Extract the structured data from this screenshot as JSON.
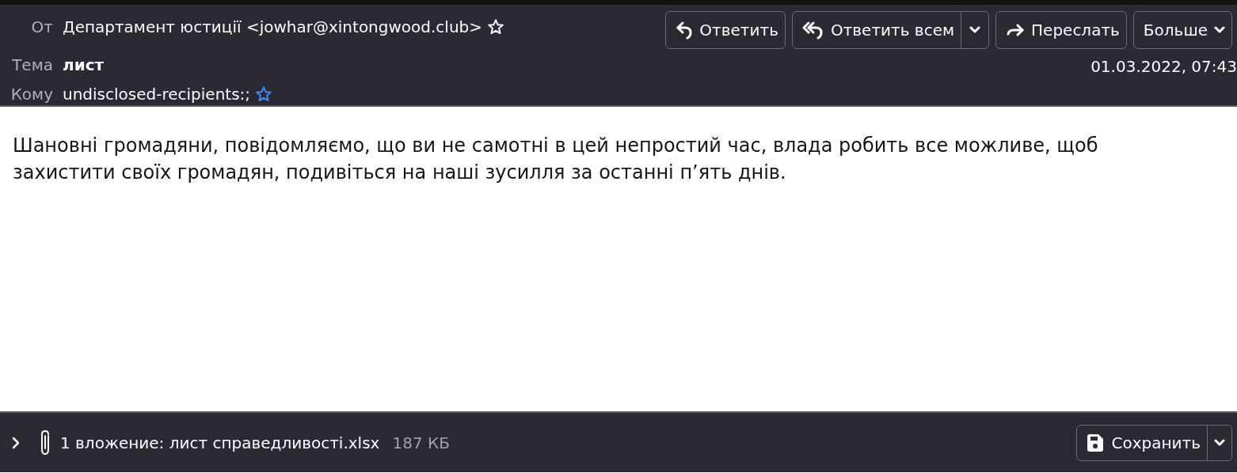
{
  "header": {
    "from": {
      "label": "От",
      "value": "Департамент юстиції <jowhar@xintongwood.club>"
    },
    "subject": {
      "label": "Тема",
      "value": "лист"
    },
    "to": {
      "label": "Кому",
      "value": "undisclosed-recipients:;"
    },
    "date": "01.03.2022, 07:43",
    "buttons": [
      {
        "kind": "reply",
        "label": "Ответить"
      },
      {
        "kind": "reply-all",
        "label": "Ответить всем",
        "dropdown": true
      },
      {
        "kind": "forward",
        "label": "Переслать"
      },
      {
        "kind": "more",
        "label": "Больше"
      }
    ]
  },
  "body": "Шановні громадяни, повідомляємо, що ви не самотні в цей непростий час, влада робить все можливе, щоб захистити своїх громадян, подивіться на наші зусилля за останні п’ять днів.",
  "attachments": {
    "expanded": false,
    "summary": "1 вложение: лист справедливості.xlsx",
    "size": "187 КБ",
    "save_button": "Сохранить"
  }
}
